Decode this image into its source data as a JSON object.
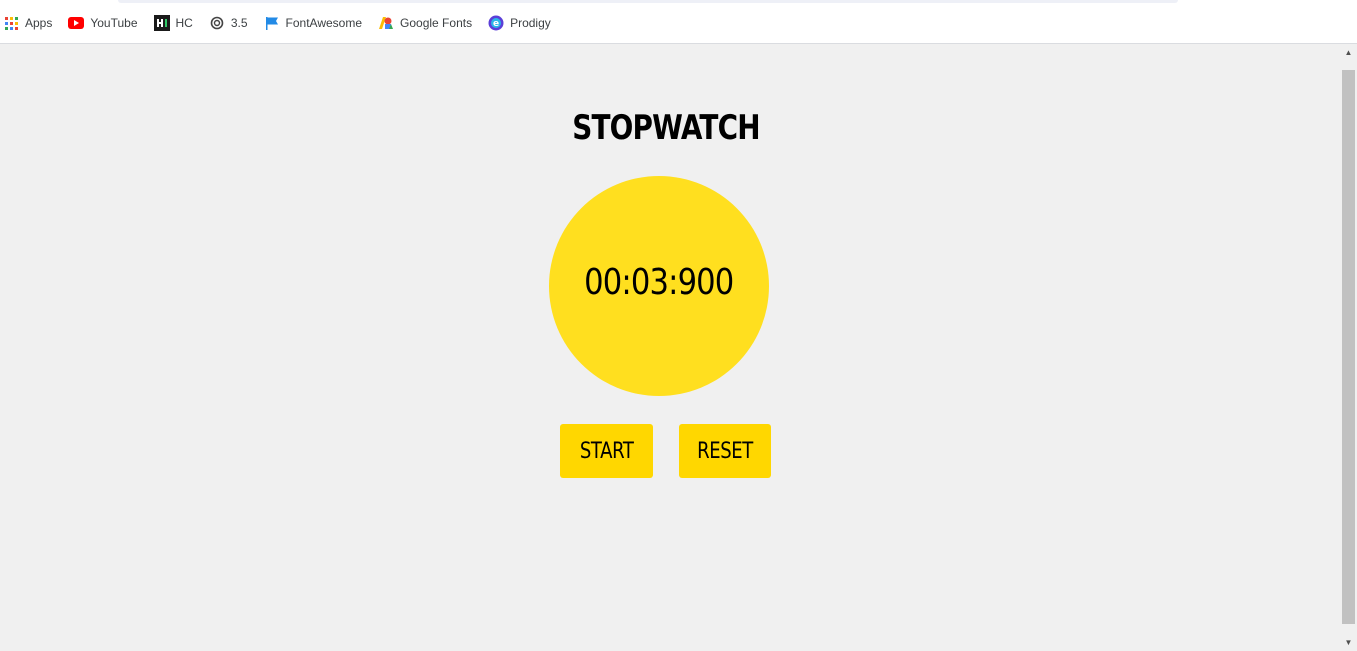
{
  "bookmarks": [
    {
      "label": "Apps",
      "icon": "apps-grid-icon"
    },
    {
      "label": "YouTube",
      "icon": "youtube-icon",
      "color": "#ff0000"
    },
    {
      "label": "HC",
      "icon": "hackerrank-icon",
      "color": "#1a1a1a"
    },
    {
      "label": "3.5",
      "icon": "openai-icon",
      "color": "#444444"
    },
    {
      "label": "FontAwesome",
      "icon": "flag-icon",
      "color": "#228ae6"
    },
    {
      "label": "Google Fonts",
      "icon": "google-fonts-icon"
    },
    {
      "label": "Prodigy",
      "icon": "prodigy-icon",
      "color": "#5b3fd8"
    }
  ],
  "stopwatch": {
    "title": "STOPWATCH",
    "time": "00:03:900",
    "start_label": "START",
    "reset_label": "RESET"
  },
  "colors": {
    "background": "#f0f0f0",
    "dial": "#ffdf1f",
    "button": "#ffd700"
  }
}
